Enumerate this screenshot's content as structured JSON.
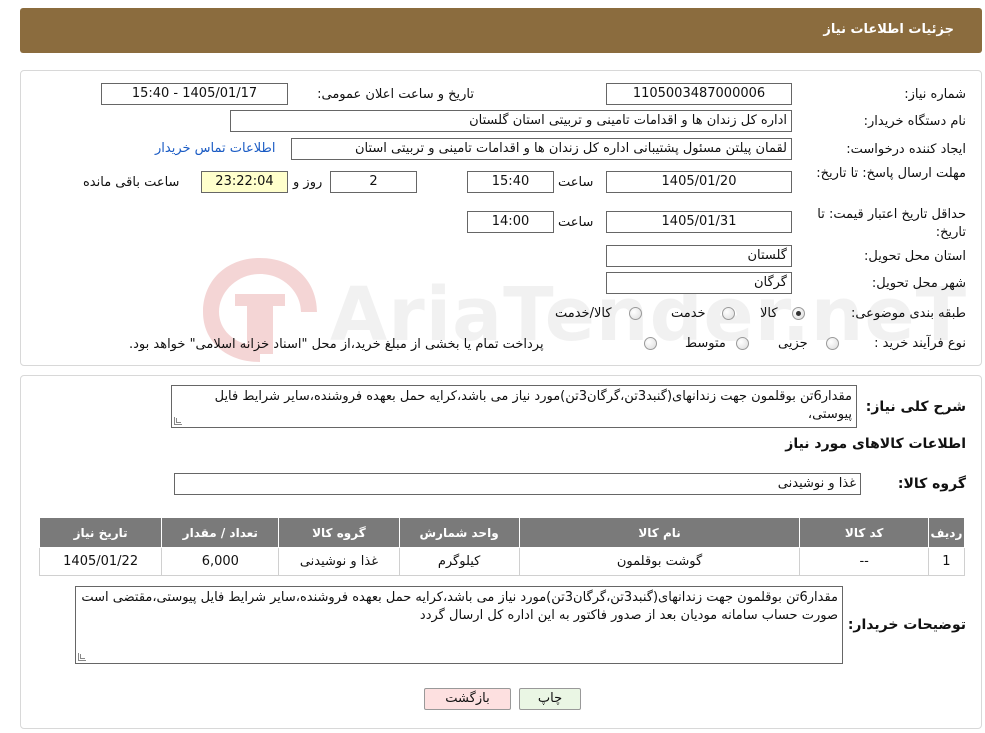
{
  "header": {
    "title": "جزئیات اطلاعات نیاز"
  },
  "form": {
    "need_number_label": "شماره نیاز:",
    "need_number_value": "1105003487000006",
    "announce_label": "تاریخ و ساعت اعلان عمومی:",
    "announce_value": "1405/01/17 - 15:40",
    "buyer_org_label": "نام دستگاه خریدار:",
    "buyer_org_value": "اداره کل زندان ها و اقدامات تامینی و تربیتی استان گلستان",
    "requester_label": "ایجاد کننده درخواست:",
    "requester_value": "لقمان پیلتن مسئول پشتیبانی اداره کل زندان ها و اقدامات تامینی و تربیتی استان",
    "contact_link": "اطلاعات تماس خریدار",
    "deadline_label": "مهلت ارسال پاسخ: تا تاریخ:",
    "deadline_date": "1405/01/20",
    "time_label": "ساعت",
    "deadline_time": "15:40",
    "days_value": "2",
    "days_label": "روز و",
    "remaining_time": "23:22:04",
    "remaining_label": "ساعت باقی مانده",
    "validity_label": "حداقل تاریخ اعتبار قیمت: تا تاریخ:",
    "validity_date": "1405/01/31",
    "validity_time": "14:00",
    "province_label": "استان محل تحویل:",
    "province_value": "گلستان",
    "city_label": "شهر محل تحویل:",
    "city_value": "گرگان",
    "category_label": "طبقه بندی موضوعی:",
    "category_options": [
      "کالا",
      "خدمت",
      "کالا/خدمت"
    ],
    "category_selected": "کالا",
    "process_label": "نوع فرآیند خرید :",
    "process_options": [
      "جزیی",
      "متوسط"
    ],
    "process_note": "پرداخت تمام یا بخشی از مبلغ خرید،از محل \"اسناد خزانه اسلامی\" خواهد بود."
  },
  "watermark": {
    "text": "AriaTender.neT"
  },
  "details": {
    "summary_label": "شرح کلی نیاز:",
    "summary_value": "مقدار6تن بوقلمون جهت زندانهای(گنبد3تن،گرگان3تن)مورد نیاز می باشد،کرایه حمل بعهده فروشنده،سایر شرایط فایل پیوستی،",
    "goods_info_title": "اطلاعات کالاهای مورد نیاز",
    "goods_group_label": "گروه کالا:",
    "goods_group_value": "غذا و نوشیدنی",
    "table": {
      "headers": [
        "ردیف",
        "کد کالا",
        "نام کالا",
        "واحد شمارش",
        "گروه کالا",
        "تعداد / مقدار",
        "تاریخ نیاز"
      ],
      "rows": [
        [
          "1",
          "--",
          "گوشت بوقلمون",
          "کیلوگرم",
          "غذا و نوشیدنی",
          "6,000",
          "1405/01/22"
        ]
      ]
    },
    "buyer_notes_label": "توضیحات خریدار:",
    "buyer_notes_value": "مقدار6تن بوقلمون جهت زندانهای(گنبد3تن،گرگان3تن)مورد نیاز می باشد،کرایه حمل بعهده فروشنده،سایر شرایط فایل پیوستی،مقتضی است صورت حساب سامانه مودیان بعد از صدور فاکتور به این اداره کل ارسال گردد"
  },
  "buttons": {
    "print": "چاپ",
    "back": "بازگشت"
  },
  "colors": {
    "header_bg": "#8b6c3e",
    "link": "#1a5bc4",
    "table_header": "#7a7a7a",
    "back_btn": "#fde0e0",
    "print_btn": "#eaf6e4"
  }
}
